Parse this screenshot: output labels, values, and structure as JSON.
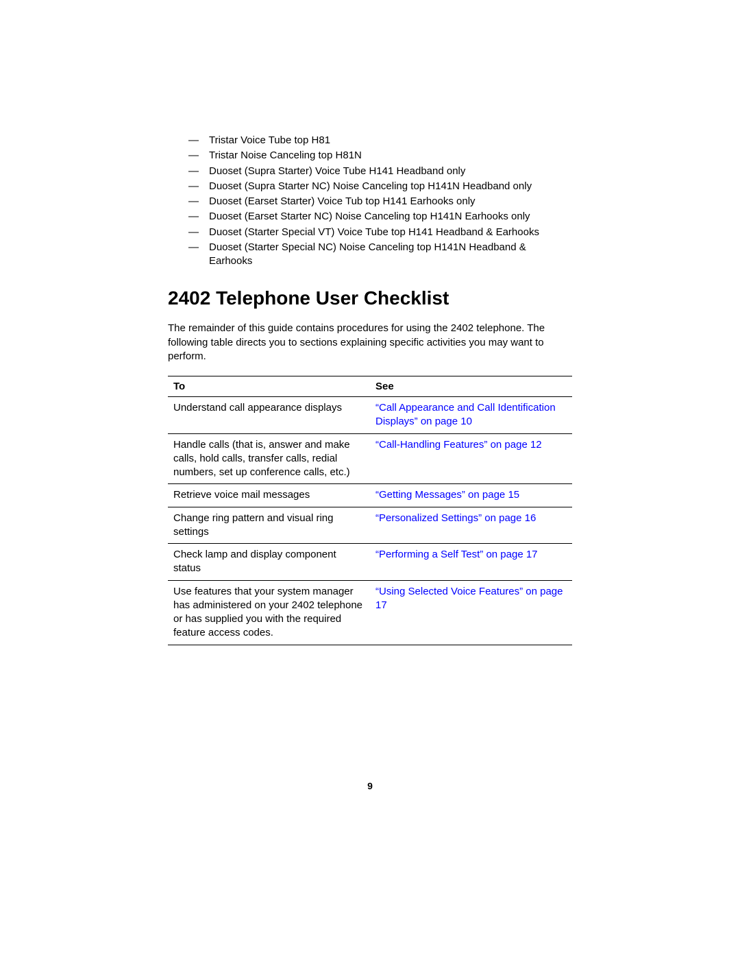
{
  "list_items": [
    "Tristar Voice Tube top H81",
    "Tristar Noise Canceling top H81N",
    "Duoset (Supra Starter) Voice Tube H141 Headband only",
    "Duoset (Supra Starter NC) Noise Canceling top H141N Headband only",
    "Duoset (Earset Starter) Voice Tub top H141 Earhooks only",
    "Duoset (Earset Starter NC) Noise Canceling top H141N Earhooks only",
    "Duoset (Starter Special VT) Voice Tube top H141 Headband & Earhooks",
    "Duoset (Starter Special NC) Noise Canceling top H141N Headband & Earhooks"
  ],
  "heading": "2402 Telephone User Checklist",
  "intro": "The remainder of this guide contains procedures for using the 2402 telephone. The following table directs you to sections explaining specific activities you may want to perform.",
  "table": {
    "header_to": "To",
    "header_see": "See",
    "rows": [
      {
        "to": "Understand call appearance displays",
        "see": "“Call Appearance and Call Identification Displays” on page 10"
      },
      {
        "to": "Handle calls (that is, answer and make calls, hold calls, transfer calls, redial numbers, set up conference calls, etc.)",
        "see": "“Call-Handling Features” on page 12"
      },
      {
        "to": "Retrieve voice mail messages",
        "see": "“Getting Messages” on page 15"
      },
      {
        "to": "Change ring pattern and visual ring settings",
        "see": "“Personalized Settings” on page 16"
      },
      {
        "to": "Check lamp and display component status",
        "see": "“Performing a Self Test” on page 17"
      },
      {
        "to": "Use features that your system manager has administered on your 2402 telephone or has supplied you with the required feature access codes.",
        "see": "“Using Selected Voice Features” on page 17"
      }
    ]
  },
  "page_number": "9"
}
